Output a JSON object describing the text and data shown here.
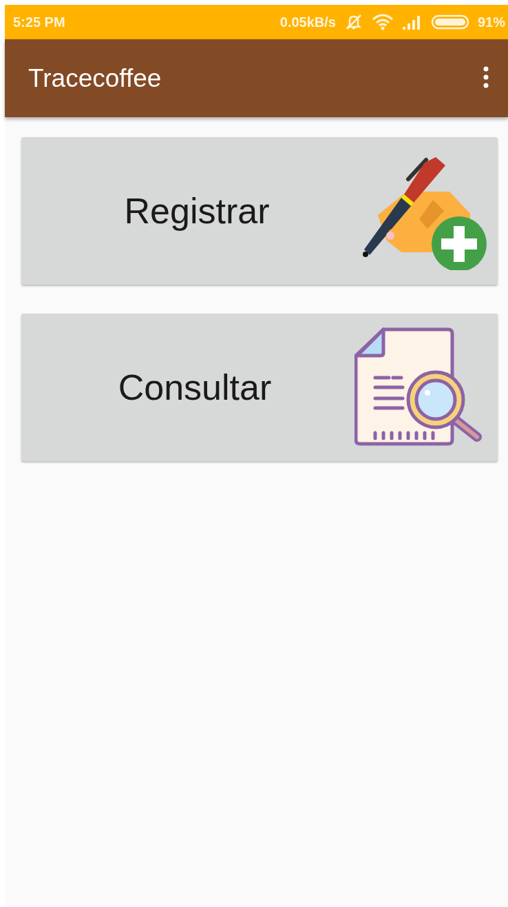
{
  "status_bar": {
    "time": "5:25 PM",
    "speed": "0.05kB/s",
    "battery": "91%"
  },
  "app_bar": {
    "title": "Tracecoffee"
  },
  "cards": [
    {
      "label": "Registrar",
      "kind": "register"
    },
    {
      "label": "Consultar",
      "kind": "search"
    }
  ]
}
